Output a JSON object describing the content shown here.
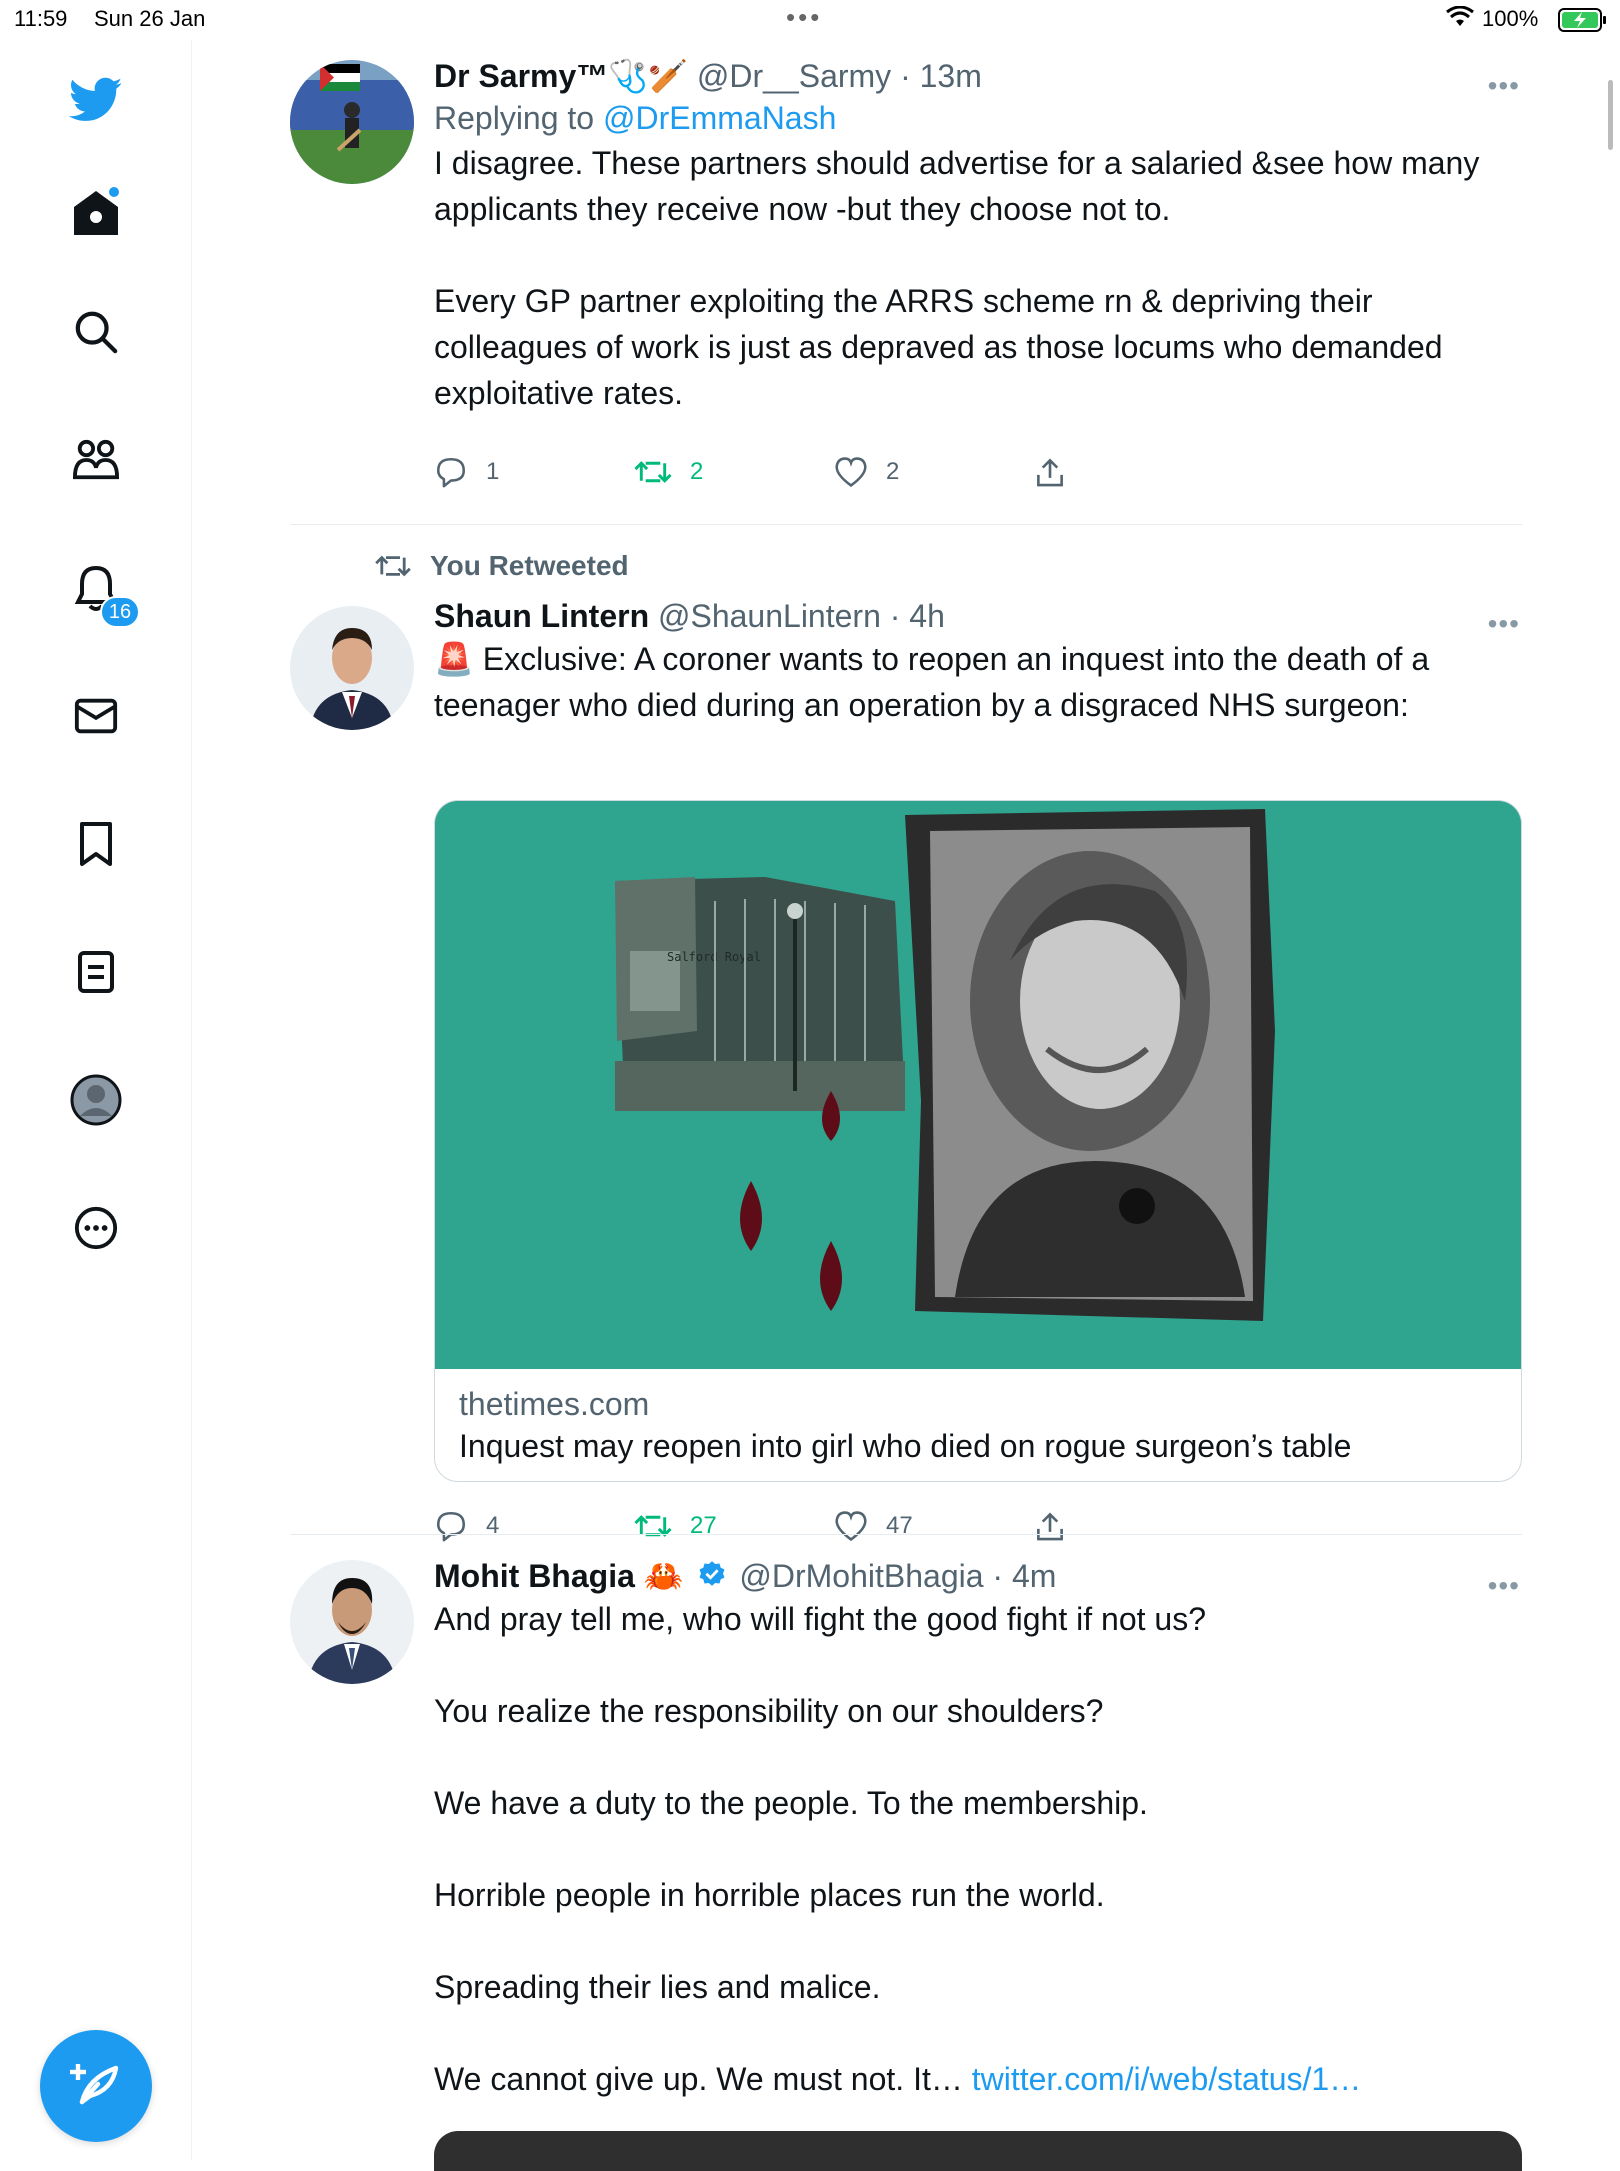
{
  "status_bar": {
    "time": "11:59",
    "date": "Sun 26 Jan",
    "battery_pct": "100%"
  },
  "sidebar": {
    "notifications_badge": "16",
    "items": [
      {
        "icon": "twitter-logo-icon"
      },
      {
        "icon": "home-icon"
      },
      {
        "icon": "search-icon"
      },
      {
        "icon": "communities-icon"
      },
      {
        "icon": "notifications-icon"
      },
      {
        "icon": "messages-icon"
      },
      {
        "icon": "bookmarks-icon"
      },
      {
        "icon": "lists-icon"
      },
      {
        "icon": "profile-icon"
      },
      {
        "icon": "more-icon"
      }
    ],
    "compose_icon": "compose-tweet-icon"
  },
  "colors": {
    "accent": "#1d9bf0",
    "retweet_green": "#00ba7c",
    "secondary_text": "#536471",
    "card_bg": "#2fa590"
  },
  "tweets": [
    {
      "name": "Dr Sarmy™🩺🏏",
      "handle": "@Dr__Sarmy",
      "time": "· 13m",
      "replying_prefix": "Replying to ",
      "replying_to": "@DrEmmaNash",
      "body": [
        "I disagree. These partners should advertise for a salaried &see how many applicants they receive now -but they choose not to.",
        "",
        "Every GP partner exploiting the ARRS scheme rn & depriving their colleagues of work is just as depraved as those locums who demanded exploitative rates."
      ],
      "replies": "1",
      "retweets": "2",
      "likes": "2"
    },
    {
      "retweet_label": "You Retweeted",
      "name": "Shaun Lintern",
      "handle": "@ShaunLintern",
      "time": "· 4h",
      "body": [
        "🚨 Exclusive: A coroner wants to reopen an inquest into the death of a teenager who died during an operation by a disgraced NHS surgeon:"
      ],
      "card": {
        "sign_text": "Salford Royal",
        "domain": "thetimes.com",
        "title": "Inquest may reopen into girl who died on rogue surgeon’s table"
      },
      "replies": "4",
      "retweets": "27",
      "likes": "47"
    },
    {
      "name": "Mohit Bhagia 🦀",
      "handle": "@DrMohitBhagia",
      "time": "· 4m",
      "body": [
        "And pray tell me, who will fight the good fight if not us?",
        "",
        "You realize the responsibility on our shoulders?",
        "",
        "We have a duty to the people. To the membership.",
        "",
        "Horrible people in horrible places run the world.",
        "",
        "Spreading their lies and malice.",
        "",
        "We cannot give up. We must not. It… "
      ],
      "link": "twitter.com/i/web/status/1…"
    }
  ]
}
